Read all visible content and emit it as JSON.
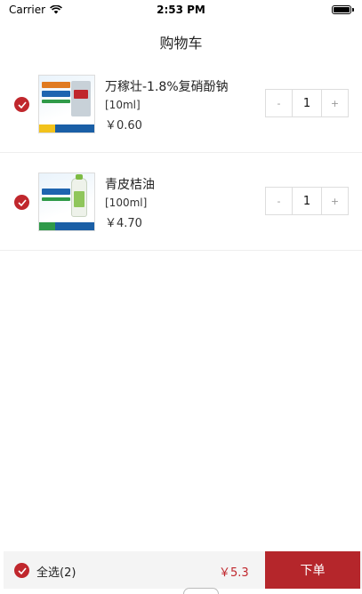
{
  "status_bar": {
    "carrier": "Carrier",
    "time": "2:53 PM",
    "battery_level": 1.0
  },
  "nav": {
    "title": "购物车"
  },
  "cart": {
    "items": [
      {
        "title": "万稼壮-1.8%复硝酚钠",
        "spec": "[10ml]",
        "price": "￥0.60",
        "quantity": "1",
        "selected": true,
        "image_icon": "product-box-image"
      },
      {
        "title": "青皮桔油",
        "spec": "[100ml]",
        "price": "￥4.70",
        "quantity": "1",
        "selected": true,
        "image_icon": "product-bottle-image"
      }
    ],
    "minus_label": "-",
    "plus_label": "+"
  },
  "footer": {
    "select_all_label": "全选(2)",
    "total": "￥5.3",
    "order_label": "下单",
    "accent_color": "#b5262b"
  }
}
